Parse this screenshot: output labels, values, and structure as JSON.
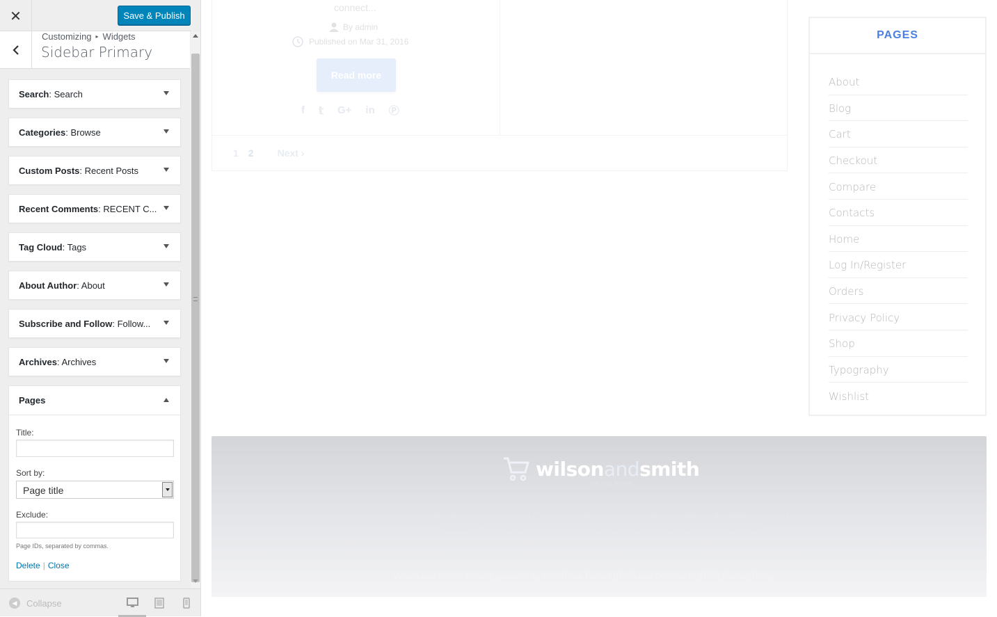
{
  "customizer": {
    "close_icon": "close-icon",
    "save_label": "Save & Publish",
    "breadcrumb": [
      "Customizing",
      "Widgets"
    ],
    "section_title": "Sidebar Primary",
    "widgets": [
      {
        "name": "Search",
        "title": "Search"
      },
      {
        "name": "Categories",
        "title": "Browse"
      },
      {
        "name": "Custom Posts",
        "title": "Recent Posts"
      },
      {
        "name": "Recent Comments",
        "title": "RECENT C..."
      },
      {
        "name": "Tag Cloud",
        "title": "Tags"
      },
      {
        "name": "About Author",
        "title": "About"
      },
      {
        "name": "Subscribe and Follow",
        "title": "Follow..."
      },
      {
        "name": "Archives",
        "title": "Archives"
      }
    ],
    "pages_widget": {
      "name": "Pages",
      "title_label": "Title:",
      "title_value": "",
      "sort_label": "Sort by:",
      "sort_value": "Page title",
      "exclude_label": "Exclude:",
      "exclude_value": "",
      "exclude_hint": "Page IDs, separated by commas.",
      "delete_label": "Delete",
      "close_label": "Close"
    },
    "collapse_label": "Collapse",
    "devices": [
      "desktop-icon",
      "tablet-icon",
      "mobile-icon"
    ]
  },
  "preview": {
    "excerpt": "connect...",
    "author": "By admin",
    "published": "Published on Mar 31, 2016",
    "read_more": "Read more",
    "social_icons": [
      "facebook-icon",
      "twitter-icon",
      "google-plus-icon",
      "linkedin-icon",
      "pinterest-icon"
    ],
    "pagination": {
      "pages": [
        "1",
        "2"
      ],
      "next": "Next ›"
    },
    "pages_widget": {
      "title": "PAGES",
      "items": [
        "About",
        "Blog",
        "Cart",
        "Checkout",
        "Compare",
        "Contacts",
        "Home",
        "Log In/Register",
        "Orders",
        "Privacy Policy",
        "Shop",
        "Typography",
        "Wishlist"
      ]
    },
    "footer": {
      "logo_part1": "wilson",
      "logo_part2": "and",
      "logo_part3": "smith",
      "tagline": "on tap store",
      "text": "Comfort is a very important thing nowadays because it is a condition of satisfaction and calmness. It is clear that our way of life must be as comfortable as possible.",
      "copyright": "Wilson and Smith | Proudly powered by WordPress  Entries (RSS) and Comments (RSS)  Privacy Policy"
    }
  },
  "colors": {
    "primary_button": "#0085ba",
    "accent_blue": "#4a7fe0",
    "link": "#0073aa"
  }
}
